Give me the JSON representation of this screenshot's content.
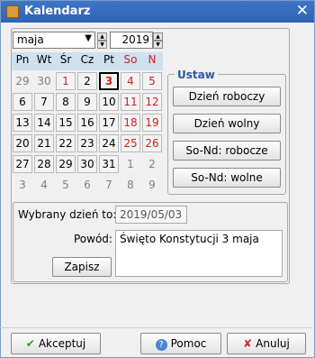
{
  "window": {
    "title": "Kalendarz",
    "close_glyph": "✕",
    "icon": "calendar-app-icon"
  },
  "month_select": {
    "value": "maja"
  },
  "year": {
    "value": "2019"
  },
  "day_headers": [
    "Pn",
    "Wt",
    "Śr",
    "Cz",
    "Pt",
    "So",
    "N"
  ],
  "weeks": [
    [
      "29",
      "30",
      "1",
      "2",
      "3",
      "4",
      "5"
    ],
    [
      "6",
      "7",
      "8",
      "9",
      "10",
      "11",
      "12"
    ],
    [
      "13",
      "14",
      "15",
      "16",
      "17",
      "18",
      "19"
    ],
    [
      "20",
      "21",
      "22",
      "23",
      "24",
      "25",
      "26"
    ],
    [
      "27",
      "28",
      "29",
      "30",
      "31",
      "1",
      "2"
    ],
    [
      "3",
      "4",
      "5",
      "6",
      "7",
      "8",
      "9"
    ]
  ],
  "ustaw": {
    "legend": "Ustaw",
    "buttons": [
      "Dzień roboczy",
      "Dzień wolny",
      "So-Nd: robocze",
      "So-Nd: wolne"
    ]
  },
  "details": {
    "date_label": "Wybrany dzień to:",
    "date_value": "2019/05/03",
    "reason_label": "Powód:",
    "reason_value": "Święto Konstytucji 3 maja",
    "save_button": "Zapisz"
  },
  "footer": {
    "accept": "Akceptuj",
    "help": "Pomoc",
    "cancel": "Anuluj"
  },
  "colors": {
    "title_bar": "#2f63b5",
    "weekend_red": "#d21f1f",
    "header_bg": "#cfe0ef",
    "ustaw_legend": "#2e5a9e"
  }
}
